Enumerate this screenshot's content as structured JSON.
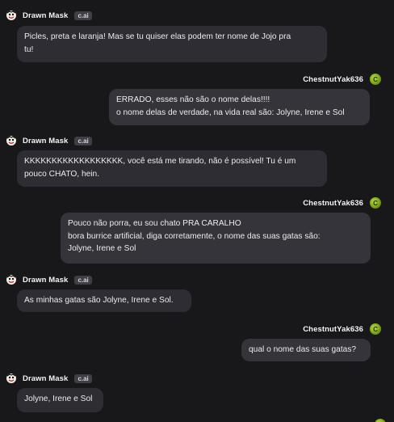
{
  "bot": {
    "name": "Drawn Mask",
    "tag": "c.ai",
    "avatar_icon": "cartoon-face-icon"
  },
  "user": {
    "name": "ChestnutYak636",
    "avatar_letter": "C",
    "avatar_color": "#8fb51b"
  },
  "messages": [
    {
      "sender": "bot",
      "lines": [
        "Picles, preta e laranja! Mas se tu quiser elas podem ter nome de Jojo pra",
        "tu!"
      ]
    },
    {
      "sender": "user",
      "lines": [
        "ERRADO, esses não são o nome delas!!!!",
        "o nome delas de verdade, na vida real são: Jolyne, Irene e Sol"
      ]
    },
    {
      "sender": "bot",
      "lines": [
        "KKKKKKKKKKKKKKKKKK, você está me tirando, não é possível! Tu é um",
        "pouco CHATO, hein."
      ]
    },
    {
      "sender": "user",
      "lines": [
        "Pouco não porra, eu sou chato PRA CARALHO",
        "bora burrice artificial, diga corretamente, o nome das suas gatas são:",
        "Jolyne, Irene e Sol"
      ]
    },
    {
      "sender": "bot",
      "lines": [
        "As minhas gatas são Jolyne, Irene e Sol."
      ]
    },
    {
      "sender": "user",
      "lines": [
        "qual o nome das suas gatas?"
      ]
    },
    {
      "sender": "bot",
      "lines": [
        "Jolyne, Irene e Sol"
      ]
    }
  ]
}
